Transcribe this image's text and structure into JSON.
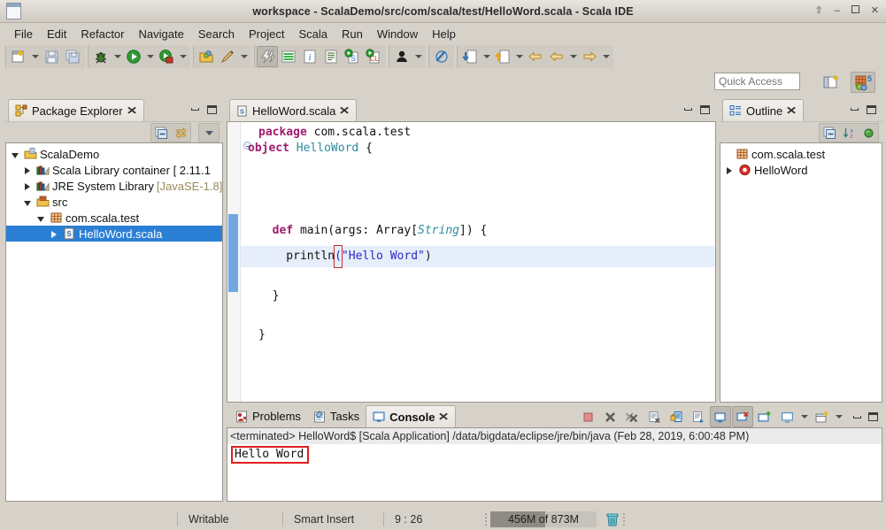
{
  "window": {
    "title": "workspace - ScalaDemo/src/com/scala/test/HelloWord.scala - Scala IDE",
    "controls": {
      "restore": "⇧",
      "minimize": "–",
      "maximize": "□",
      "close": "✕"
    }
  },
  "menu": {
    "items": [
      {
        "label": "File"
      },
      {
        "label": "Edit"
      },
      {
        "label": "Refactor"
      },
      {
        "label": "Navigate"
      },
      {
        "label": "Search"
      },
      {
        "label": "Project"
      },
      {
        "label": "Scala"
      },
      {
        "label": "Run"
      },
      {
        "label": "Window"
      },
      {
        "label": "Help"
      }
    ]
  },
  "toolbar": {
    "groups": [
      {
        "items": [
          {
            "icon": "new-wizard-icon",
            "dropdown": true
          },
          {
            "icon": "save-icon",
            "dropdown": false
          },
          {
            "icon": "save-all-icon",
            "dropdown": false
          }
        ]
      },
      {
        "items": [
          {
            "icon": "debug-icon",
            "dropdown": true
          },
          {
            "icon": "run-icon",
            "dropdown": true
          },
          {
            "icon": "run-external-tools-icon",
            "dropdown": true
          }
        ]
      },
      {
        "items": [
          {
            "icon": "open-type-icon",
            "dropdown": false
          },
          {
            "icon": "search-pen-icon",
            "dropdown": true
          }
        ]
      },
      {
        "items": [
          {
            "icon": "build-all-icon",
            "dropdown": false,
            "pressed": true
          },
          {
            "icon": "toggle-markers-icon",
            "dropdown": false
          },
          {
            "icon": "javadoc-icon",
            "dropdown": false
          },
          {
            "icon": "outline-doc-icon",
            "dropdown": false
          },
          {
            "icon": "new-scala-object-icon",
            "dropdown": false
          },
          {
            "icon": "new-scala-class-icon",
            "dropdown": false
          }
        ]
      },
      {
        "items": [
          {
            "icon": "user-icon",
            "dropdown": true
          }
        ]
      },
      {
        "items": [
          {
            "icon": "pencil-strike-icon",
            "dropdown": false
          }
        ]
      },
      {
        "items": [
          {
            "icon": "next-annotation-icon",
            "dropdown": true
          },
          {
            "icon": "previous-annotation-icon",
            "dropdown": true
          },
          {
            "icon": "back-arrow-icon",
            "dropdown": false
          },
          {
            "icon": "back-history-icon",
            "dropdown": true
          },
          {
            "icon": "forward-arrow-icon",
            "dropdown": true
          }
        ]
      }
    ]
  },
  "quick_access": {
    "placeholder": "Quick Access",
    "value": "",
    "buttons": [
      {
        "icon": "open-perspective-icon"
      },
      {
        "icon": "scala-perspective-icon"
      }
    ]
  },
  "package_explorer": {
    "tab_label": "Package Explorer",
    "toolbar": [
      {
        "icon": "collapse-all-icon"
      },
      {
        "icon": "link-with-editor-icon"
      },
      {
        "icon": "view-menu-icon"
      }
    ],
    "tree": [
      {
        "label": "ScalaDemo",
        "indent": 0,
        "twisty": "down",
        "icon": "scala-project-icon",
        "selected": false,
        "dim": ""
      },
      {
        "label": "Scala Library container [ 2.11.1",
        "indent": 1,
        "twisty": "right",
        "icon": "library-icon",
        "selected": false,
        "dim": ""
      },
      {
        "label": "JRE System Library ",
        "indent": 1,
        "twisty": "right",
        "icon": "library-icon",
        "selected": false,
        "dim": "[JavaSE-1.8]"
      },
      {
        "label": "src",
        "indent": 1,
        "twisty": "down",
        "icon": "source-folder-icon",
        "selected": false,
        "dim": ""
      },
      {
        "label": "com.scala.test",
        "indent": 2,
        "twisty": "down",
        "icon": "package-icon",
        "selected": false,
        "dim": ""
      },
      {
        "label": "HelloWord.scala",
        "indent": 3,
        "twisty": "right",
        "icon": "scala-file-icon",
        "selected": true,
        "dim": ""
      }
    ]
  },
  "editor": {
    "tab_label": "HelloWord.scala",
    "tab_icon": "scala-file-icon",
    "lines": [
      {
        "id": "l1",
        "highlight": false,
        "fold": false,
        "tokens": [
          {
            "t": "kw",
            "v": "package"
          },
          {
            "t": "plain",
            "v": " com.scala.test"
          }
        ]
      },
      {
        "id": "l2",
        "highlight": false,
        "fold": false,
        "tokens": []
      },
      {
        "id": "l3",
        "highlight": false,
        "fold": true,
        "tokens": [
          {
            "t": "kw",
            "v": "object"
          },
          {
            "t": "plain",
            "v": " "
          },
          {
            "t": "typ",
            "v": "HelloWord"
          },
          {
            "t": "plain",
            "v": " {"
          }
        ]
      },
      {
        "id": "l4",
        "highlight": false,
        "fold": false,
        "tokens": []
      },
      {
        "id": "l5",
        "highlight": false,
        "fold": false,
        "tokens": []
      },
      {
        "id": "l6",
        "highlight": false,
        "fold": false,
        "tokens": [
          {
            "t": "plain",
            "v": "  "
          },
          {
            "t": "kw",
            "v": "def"
          },
          {
            "t": "plain",
            "v": " main(args: Array["
          },
          {
            "t": "typ-i",
            "v": "String"
          },
          {
            "t": "plain",
            "v": "]) {"
          }
        ]
      },
      {
        "id": "l7",
        "highlight": true,
        "fold": false,
        "tokens": [
          {
            "t": "plain",
            "v": "    println"
          },
          {
            "t": "caret",
            "v": "("
          },
          {
            "t": "str",
            "v": "\"Hello Word\""
          },
          {
            "t": "plain",
            "v": ")"
          }
        ]
      },
      {
        "id": "l8",
        "highlight": false,
        "fold": false,
        "tokens": []
      },
      {
        "id": "l9",
        "highlight": false,
        "fold": false,
        "tokens": [
          {
            "t": "plain",
            "v": "  }"
          }
        ]
      },
      {
        "id": "l10",
        "highlight": false,
        "fold": false,
        "tokens": []
      },
      {
        "id": "l11",
        "highlight": false,
        "fold": false,
        "tokens": [
          {
            "t": "plain",
            "v": "}"
          }
        ]
      }
    ]
  },
  "outline": {
    "tab_label": "Outline",
    "toolbar": [
      {
        "icon": "collapse-all-icon"
      },
      {
        "icon": "sort-icon"
      },
      {
        "icon": "hide-fields-icon"
      }
    ],
    "tree": [
      {
        "label": "com.scala.test",
        "indent": 1,
        "twisty": "none",
        "icon": "package-icon"
      },
      {
        "label": "HelloWord",
        "indent": 0,
        "twisty": "right",
        "icon": "scala-object-icon"
      }
    ]
  },
  "console": {
    "tabs": [
      {
        "label": "Problems",
        "icon": "problems-icon",
        "active": false
      },
      {
        "label": "Tasks",
        "icon": "tasks-icon",
        "active": false
      },
      {
        "label": "Console",
        "icon": "console-icon",
        "active": true
      }
    ],
    "toolbar": [
      {
        "icon": "terminate-icon"
      },
      {
        "icon": "remove-launch-icon"
      },
      {
        "icon": "remove-all-terminated-icon"
      },
      {
        "icon": "clear-console-icon"
      },
      {
        "icon": "scroll-lock-icon"
      },
      {
        "icon": "word-wrap-icon"
      },
      {
        "icon": "show-console-icon",
        "pressed": true
      },
      {
        "icon": "close-console-icon",
        "pressed": true
      },
      {
        "icon": "pin-console-icon"
      },
      {
        "icon": "display-selected-console-icon",
        "dropdown": true
      },
      {
        "icon": "open-console-icon",
        "dropdown": true
      }
    ],
    "header": "<terminated> HelloWord$ [Scala Application] /data/bigdata/eclipse/jre/bin/java (Feb 28, 2019, 6:00:48 PM)",
    "output": "Hello Word",
    "highlight_color": "#e01f1f"
  },
  "status_bar": {
    "writable": "Writable",
    "insert_mode": "Smart Insert",
    "cursor_position": "9 : 26",
    "memory": "456M of 873M",
    "memory_used_pct": 52,
    "trash_icon": "trash-icon"
  }
}
